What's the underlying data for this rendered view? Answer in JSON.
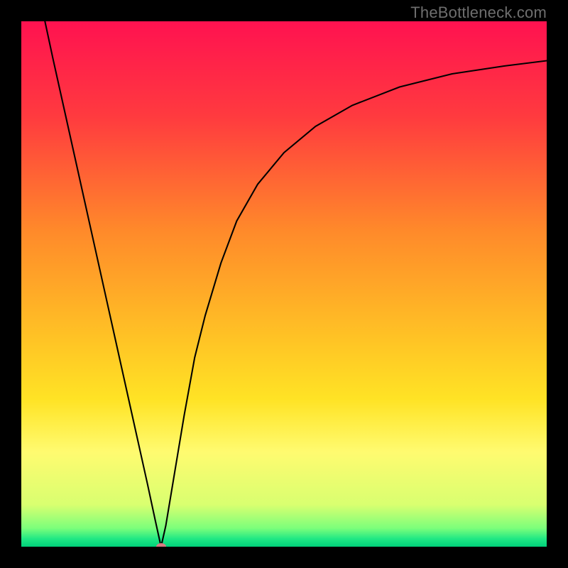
{
  "watermark": "TheBottleneck.com",
  "chart_data": {
    "type": "line",
    "title": "",
    "xlabel": "",
    "ylabel": "",
    "xlim": [
      0,
      100
    ],
    "ylim": [
      0,
      100
    ],
    "gradient_stops": [
      {
        "offset": 0,
        "color": "#ff1250"
      },
      {
        "offset": 0.18,
        "color": "#ff3a3f"
      },
      {
        "offset": 0.4,
        "color": "#ff8a2a"
      },
      {
        "offset": 0.6,
        "color": "#ffc225"
      },
      {
        "offset": 0.72,
        "color": "#ffe325"
      },
      {
        "offset": 0.82,
        "color": "#fffb70"
      },
      {
        "offset": 0.92,
        "color": "#d9ff70"
      },
      {
        "offset": 0.965,
        "color": "#7bff7b"
      },
      {
        "offset": 0.985,
        "color": "#20e884"
      },
      {
        "offset": 1.0,
        "color": "#00d07a"
      }
    ],
    "left_branch": [
      {
        "x": 4.5,
        "y": 100
      },
      {
        "x": 6.0,
        "y": 93
      },
      {
        "x": 8.0,
        "y": 84
      },
      {
        "x": 10.0,
        "y": 75
      },
      {
        "x": 12.0,
        "y": 66
      },
      {
        "x": 14.0,
        "y": 57
      },
      {
        "x": 16.0,
        "y": 48
      },
      {
        "x": 18.0,
        "y": 39
      },
      {
        "x": 20.0,
        "y": 30
      },
      {
        "x": 22.0,
        "y": 21
      },
      {
        "x": 24.0,
        "y": 12
      },
      {
        "x": 25.5,
        "y": 5
      },
      {
        "x": 26.6,
        "y": 0
      }
    ],
    "right_branch": [
      {
        "x": 26.6,
        "y": 0
      },
      {
        "x": 27.5,
        "y": 4
      },
      {
        "x": 29.0,
        "y": 13
      },
      {
        "x": 31.0,
        "y": 25
      },
      {
        "x": 33.0,
        "y": 36
      },
      {
        "x": 35.0,
        "y": 44
      },
      {
        "x": 38.0,
        "y": 54
      },
      {
        "x": 41.0,
        "y": 62
      },
      {
        "x": 45.0,
        "y": 69
      },
      {
        "x": 50.0,
        "y": 75
      },
      {
        "x": 56.0,
        "y": 80
      },
      {
        "x": 63.0,
        "y": 84
      },
      {
        "x": 72.0,
        "y": 87.5
      },
      {
        "x": 82.0,
        "y": 90
      },
      {
        "x": 92.0,
        "y": 91.5
      },
      {
        "x": 100.0,
        "y": 92.5
      }
    ],
    "minimum_point": {
      "x": 26.6,
      "y": 0
    },
    "minimum_marker_color": "#d97a82"
  }
}
